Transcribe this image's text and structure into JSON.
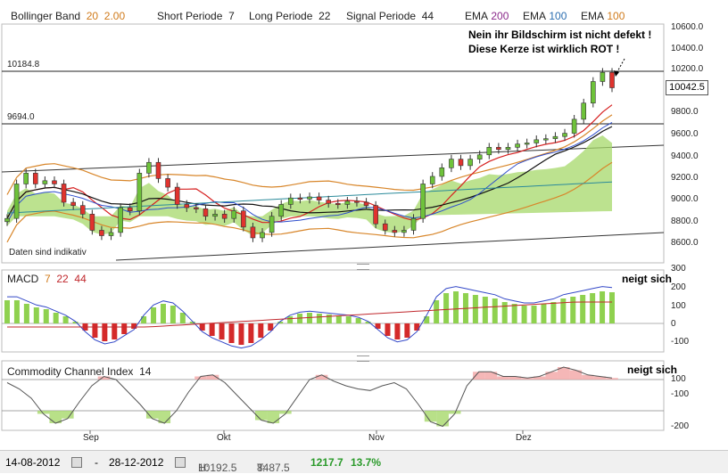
{
  "header": {
    "bb_label": "Bollinger Band",
    "bb_period": "20",
    "bb_dev": "2.00",
    "short_label": "Short Periode",
    "short_val": "7",
    "long_label": "Long Periode",
    "long_val": "22",
    "signal_label": "Signal Periode",
    "signal_val": "44",
    "ema_label": "EMA",
    "ema1": "200",
    "ema2": "100",
    "ema3": "100"
  },
  "price_panel": {
    "level1": "10184.8",
    "level2": "9694.0",
    "current": "10042.5",
    "note": "Daten sind indikativ",
    "annotation_line1": "Nein ihr Bildschirm ist nicht defekt !",
    "annotation_line2": "Diese Kerze ist wirklich ROT !",
    "yticks": [
      "10600.0",
      "10400.0",
      "10200.0",
      "9800.0",
      "9600.0",
      "9400.0",
      "9200.0",
      "9000.0",
      "8800.0",
      "8600.0"
    ]
  },
  "macd_panel": {
    "label": "MACD",
    "p1": "7",
    "p2": "22",
    "p3": "44",
    "note": "neigt sich",
    "yticks": [
      "300",
      "200",
      "100",
      "0",
      "-100"
    ]
  },
  "cci_panel": {
    "label": "Commodity Channel Index",
    "period": "14",
    "note": "neigt sich",
    "yticks": [
      "100",
      "-100",
      "-200"
    ]
  },
  "xaxis": [
    "Sep",
    "Okt",
    "Nov",
    "Dez"
  ],
  "footer": {
    "start": "14-08-2012",
    "end": "28-12-2012",
    "h_label": "H:",
    "h_val": "10192.5",
    "t_label": "T:",
    "t_val": "8487.5",
    "diff": "1217.7",
    "pct": "13.7%"
  },
  "colors": {
    "up": "#6ec23a",
    "down": "#e0332e",
    "macd_hist_up": "#8fd14f",
    "macd_hist_down": "#d42a2a",
    "cloud_green": "#a6d86a",
    "cloud_red": "#f2a5a5",
    "bollinger": "#d8862a",
    "ema200": "#7a1f8e",
    "ema100": "#2d4dcc"
  },
  "chart_data": [
    {
      "type": "line",
      "name": "candles",
      "x": [
        "Sep",
        "Okt",
        "Nov",
        "Dez"
      ],
      "ylim": [
        8500,
        10650
      ],
      "closes": [
        8830,
        9150,
        9250,
        9150,
        9180,
        9150,
        8980,
        8950,
        8870,
        8720,
        8670,
        8700,
        8930,
        8900,
        9250,
        9350,
        9200,
        9120,
        8960,
        8930,
        8920,
        8850,
        8870,
        8830,
        8900,
        8750,
        8650,
        8700,
        8850,
        8960,
        9020,
        9010,
        9030,
        9000,
        8970,
        8960,
        8990,
        8980,
        8950,
        8780,
        8720,
        8700,
        8720,
        8830,
        9150,
        9220,
        9300,
        9380,
        9320,
        9380,
        9420,
        9490,
        9470,
        9490,
        9520,
        9530,
        9560,
        9570,
        9590,
        9620,
        9750,
        9900,
        10100,
        10185,
        10042
      ]
    },
    {
      "type": "bar",
      "name": "MACD",
      "ylim": [
        -150,
        300
      ],
      "values": [
        130,
        130,
        110,
        90,
        80,
        60,
        40,
        10,
        -40,
        -80,
        -100,
        -90,
        -60,
        -30,
        40,
        90,
        110,
        100,
        60,
        10,
        -40,
        -70,
        -90,
        -110,
        -120,
        -110,
        -80,
        -40,
        10,
        40,
        55,
        60,
        55,
        50,
        45,
        40,
        30,
        10,
        -30,
        -70,
        -90,
        -80,
        -40,
        40,
        130,
        170,
        180,
        170,
        160,
        150,
        140,
        120,
        110,
        100,
        100,
        110,
        120,
        140,
        150,
        160,
        170,
        180,
        175
      ]
    },
    {
      "type": "line",
      "name": "CCI",
      "ylim": [
        -220,
        130
      ],
      "values": [
        80,
        40,
        -20,
        -120,
        -180,
        -150,
        -40,
        60,
        120,
        100,
        20,
        -60,
        -150,
        -180,
        -100,
        20,
        120,
        130,
        80,
        0,
        -80,
        -160,
        -180,
        -120,
        -10,
        100,
        130,
        90,
        60,
        40,
        30,
        60,
        80,
        40,
        -60,
        -170,
        -200,
        -120,
        60,
        150,
        150,
        120,
        120,
        110,
        120,
        150,
        180,
        160,
        130,
        120,
        110
      ]
    }
  ]
}
